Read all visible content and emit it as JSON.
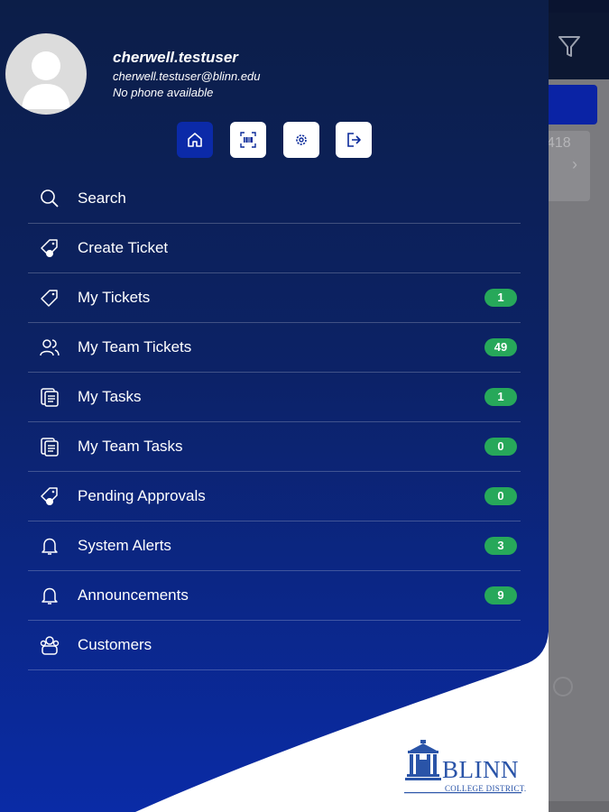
{
  "background": {
    "partial_number": "418"
  },
  "user": {
    "name": "cherwell.testuser",
    "email": "cherwell.testuser@blinn.edu",
    "phone": "No phone available"
  },
  "quick_actions": [
    {
      "icon": "home-icon",
      "active": true
    },
    {
      "icon": "barcode-scan-icon",
      "active": false
    },
    {
      "icon": "gear-icon",
      "active": false
    },
    {
      "icon": "logout-icon",
      "active": false
    }
  ],
  "menu": [
    {
      "icon": "search-icon",
      "label": "Search",
      "badge": ""
    },
    {
      "icon": "ticket-add-icon",
      "label": "Create Ticket",
      "badge": ""
    },
    {
      "icon": "ticket-icon",
      "label": "My Tickets",
      "badge": "1"
    },
    {
      "icon": "team-icon",
      "label": "My Team Tickets",
      "badge": "49"
    },
    {
      "icon": "tasks-icon",
      "label": "My Tasks",
      "badge": "1"
    },
    {
      "icon": "tasks-icon",
      "label": "My Team Tasks",
      "badge": "0"
    },
    {
      "icon": "ticket-add-icon",
      "label": "Pending Approvals",
      "badge": "0"
    },
    {
      "icon": "bell-icon",
      "label": "System Alerts",
      "badge": "3"
    },
    {
      "icon": "bell-icon",
      "label": "Announcements",
      "badge": "9"
    },
    {
      "icon": "customers-icon",
      "label": "Customers",
      "badge": ""
    }
  ],
  "logo": {
    "name": "BLINN",
    "subtitle": "COLLEGE DISTRICT."
  },
  "colors": {
    "drawer_top": "#0c1e48",
    "drawer_bottom": "#0a2ba6",
    "badge": "#27a85a",
    "active_button": "#0b2aa8",
    "logo": "#2a54a8"
  }
}
